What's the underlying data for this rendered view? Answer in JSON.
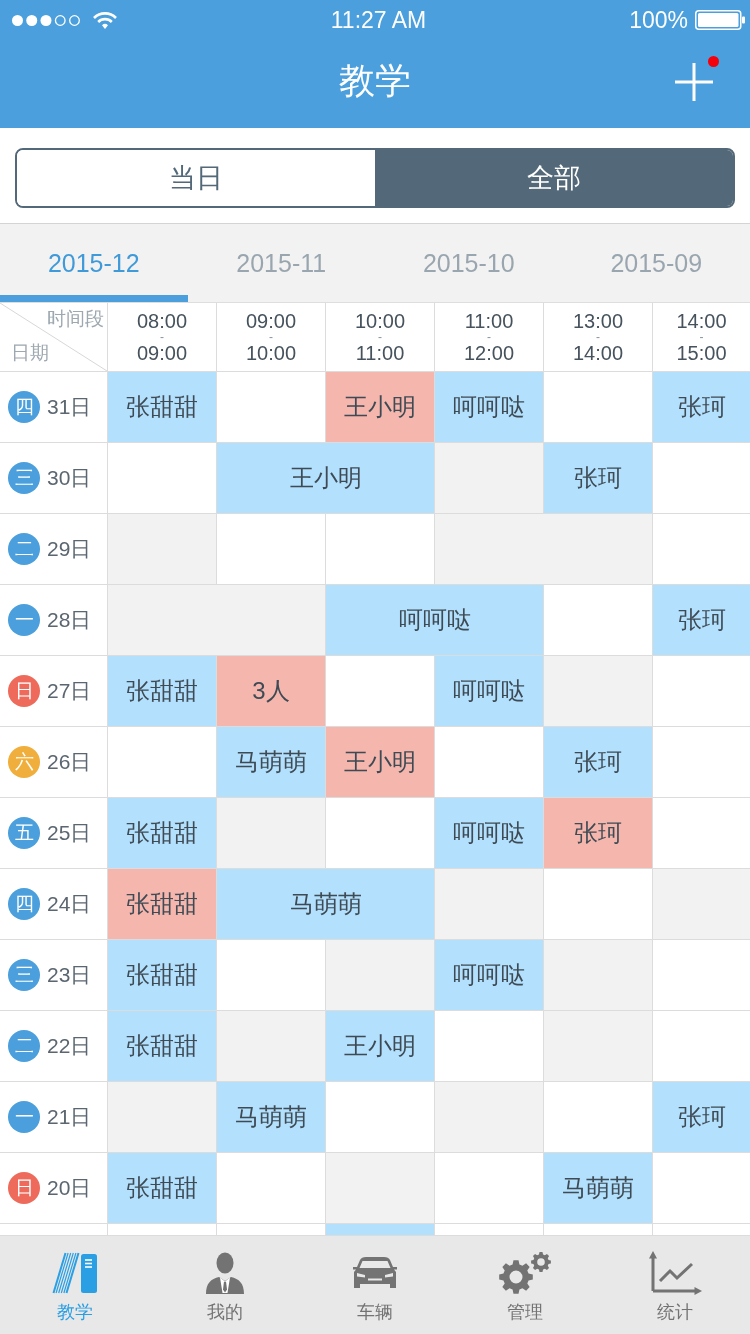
{
  "status_bar": {
    "time": "11:27 AM",
    "battery": "100%"
  },
  "header": {
    "title": "教学",
    "add_button": {
      "has_notification": true
    }
  },
  "segments": [
    {
      "label": "当日",
      "selected": false
    },
    {
      "label": "全部",
      "selected": true
    }
  ],
  "month_tabs": [
    {
      "label": "2015-12",
      "selected": true
    },
    {
      "label": "2015-11",
      "selected": false
    },
    {
      "label": "2015-10",
      "selected": false
    },
    {
      "label": "2015-09",
      "selected": false
    }
  ],
  "schedule": {
    "corner": {
      "column_axis": "时间段",
      "row_axis": "日期"
    },
    "time_slots": [
      {
        "start": "08:00",
        "separator": "-",
        "end": "09:00"
      },
      {
        "start": "09:00",
        "separator": "-",
        "end": "10:00"
      },
      {
        "start": "10:00",
        "separator": "-",
        "end": "11:00"
      },
      {
        "start": "11:00",
        "separator": "-",
        "end": "12:00"
      },
      {
        "start": "13:00",
        "separator": "-",
        "end": "14:00"
      },
      {
        "start": "14:00",
        "separator": "-",
        "end": "15:00"
      }
    ],
    "rows": [
      {
        "weekday": {
          "label": "四",
          "color": "#4a9fdc"
        },
        "date": "31日",
        "cells": [
          {
            "kind": "booked",
            "name": "张甜甜"
          },
          {
            "kind": "open"
          },
          {
            "kind": "flagged",
            "name": "王小明"
          },
          {
            "kind": "booked",
            "name": "呵呵哒"
          },
          {
            "kind": "open"
          },
          {
            "kind": "booked",
            "name": "张珂"
          }
        ]
      },
      {
        "weekday": {
          "label": "三",
          "color": "#4a9fdc"
        },
        "date": "30日",
        "cells": [
          {
            "kind": "open"
          },
          {
            "kind": "booked",
            "name": "王小明"
          },
          {
            "kind": "merged"
          },
          {
            "kind": "blocked"
          },
          {
            "kind": "booked",
            "name": "张珂"
          },
          {
            "kind": "open"
          }
        ]
      },
      {
        "weekday": {
          "label": "二",
          "color": "#4a9fdc"
        },
        "date": "29日",
        "cells": [
          {
            "kind": "blocked"
          },
          {
            "kind": "open"
          },
          {
            "kind": "open"
          },
          {
            "kind": "blocked"
          },
          {
            "kind": "merged"
          },
          {
            "kind": "open"
          }
        ]
      },
      {
        "weekday": {
          "label": "一",
          "color": "#4a9fdc"
        },
        "date": "28日",
        "cells": [
          {
            "kind": "blocked"
          },
          {
            "kind": "merged"
          },
          {
            "kind": "booked",
            "name": "呵呵哒"
          },
          {
            "kind": "merged"
          },
          {
            "kind": "open"
          },
          {
            "kind": "booked",
            "name": "张珂"
          }
        ]
      },
      {
        "weekday": {
          "label": "日",
          "color": "#ee6b5b"
        },
        "date": "27日",
        "cells": [
          {
            "kind": "booked",
            "name": "张甜甜"
          },
          {
            "kind": "flagged",
            "name": "3人"
          },
          {
            "kind": "open"
          },
          {
            "kind": "booked",
            "name": "呵呵哒"
          },
          {
            "kind": "blocked"
          },
          {
            "kind": "open"
          }
        ]
      },
      {
        "weekday": {
          "label": "六",
          "color": "#f0ae3c"
        },
        "date": "26日",
        "cells": [
          {
            "kind": "open"
          },
          {
            "kind": "booked",
            "name": "马萌萌"
          },
          {
            "kind": "flagged",
            "name": "王小明"
          },
          {
            "kind": "open"
          },
          {
            "kind": "booked",
            "name": "张珂"
          },
          {
            "kind": "open"
          }
        ]
      },
      {
        "weekday": {
          "label": "五",
          "color": "#4a9fdc"
        },
        "date": "25日",
        "cells": [
          {
            "kind": "booked",
            "name": "张甜甜"
          },
          {
            "kind": "blocked"
          },
          {
            "kind": "open"
          },
          {
            "kind": "booked",
            "name": "呵呵哒"
          },
          {
            "kind": "flagged",
            "name": "张珂"
          },
          {
            "kind": "open"
          }
        ]
      },
      {
        "weekday": {
          "label": "四",
          "color": "#4a9fdc"
        },
        "date": "24日",
        "cells": [
          {
            "kind": "flagged",
            "name": "张甜甜"
          },
          {
            "kind": "booked",
            "name": "马萌萌"
          },
          {
            "kind": "merged"
          },
          {
            "kind": "blocked"
          },
          {
            "kind": "open"
          },
          {
            "kind": "blocked"
          }
        ]
      },
      {
        "weekday": {
          "label": "三",
          "color": "#4a9fdc"
        },
        "date": "23日",
        "cells": [
          {
            "kind": "booked",
            "name": "张甜甜"
          },
          {
            "kind": "open"
          },
          {
            "kind": "blocked"
          },
          {
            "kind": "booked",
            "name": "呵呵哒"
          },
          {
            "kind": "blocked"
          },
          {
            "kind": "open"
          }
        ]
      },
      {
        "weekday": {
          "label": "二",
          "color": "#4a9fdc"
        },
        "date": "22日",
        "cells": [
          {
            "kind": "booked",
            "name": "张甜甜"
          },
          {
            "kind": "blocked"
          },
          {
            "kind": "booked",
            "name": "王小明"
          },
          {
            "kind": "open"
          },
          {
            "kind": "blocked"
          },
          {
            "kind": "open"
          }
        ]
      },
      {
        "weekday": {
          "label": "一",
          "color": "#4a9fdc"
        },
        "date": "21日",
        "cells": [
          {
            "kind": "blocked"
          },
          {
            "kind": "booked",
            "name": "马萌萌"
          },
          {
            "kind": "open"
          },
          {
            "kind": "blocked"
          },
          {
            "kind": "open"
          },
          {
            "kind": "booked",
            "name": "张珂"
          }
        ]
      },
      {
        "weekday": {
          "label": "日",
          "color": "#ee6b5b"
        },
        "date": "20日",
        "cells": [
          {
            "kind": "booked",
            "name": "张甜甜"
          },
          {
            "kind": "open"
          },
          {
            "kind": "blocked"
          },
          {
            "kind": "open"
          },
          {
            "kind": "booked",
            "name": "马萌萌"
          },
          {
            "kind": "open"
          }
        ]
      },
      {
        "cells": [
          {
            "kind": "open"
          },
          {
            "kind": "open"
          },
          {
            "kind": "booked"
          },
          {
            "kind": "open"
          },
          {
            "kind": "open"
          },
          {
            "kind": "open"
          }
        ]
      }
    ]
  },
  "tab_bar": [
    {
      "label": "教学",
      "selected": true
    },
    {
      "label": "我的",
      "selected": false
    },
    {
      "label": "车辆",
      "selected": false
    },
    {
      "label": "管理",
      "selected": false
    },
    {
      "label": "统计",
      "selected": false
    }
  ]
}
